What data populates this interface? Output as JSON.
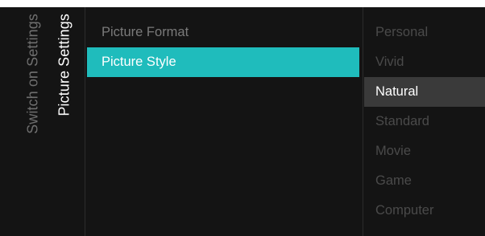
{
  "breadcrumb": {
    "parent": "Switch on Settings",
    "current": "Picture Settings"
  },
  "menu": {
    "items": [
      {
        "label": "Picture Format",
        "selected": false
      },
      {
        "label": "Picture Style",
        "selected": true
      }
    ]
  },
  "options": {
    "items": [
      {
        "label": "Personal",
        "active": false
      },
      {
        "label": "Vivid",
        "active": false
      },
      {
        "label": "Natural",
        "active": true
      },
      {
        "label": "Standard",
        "active": false
      },
      {
        "label": "Movie",
        "active": false
      },
      {
        "label": "Game",
        "active": false
      },
      {
        "label": "Computer",
        "active": false
      }
    ]
  },
  "colors": {
    "background": "#141414",
    "highlight": "#1fbcbc",
    "active_option": "#3a3a3a",
    "text_active": "#ffffff",
    "text_dim": "#7a7a7a"
  }
}
